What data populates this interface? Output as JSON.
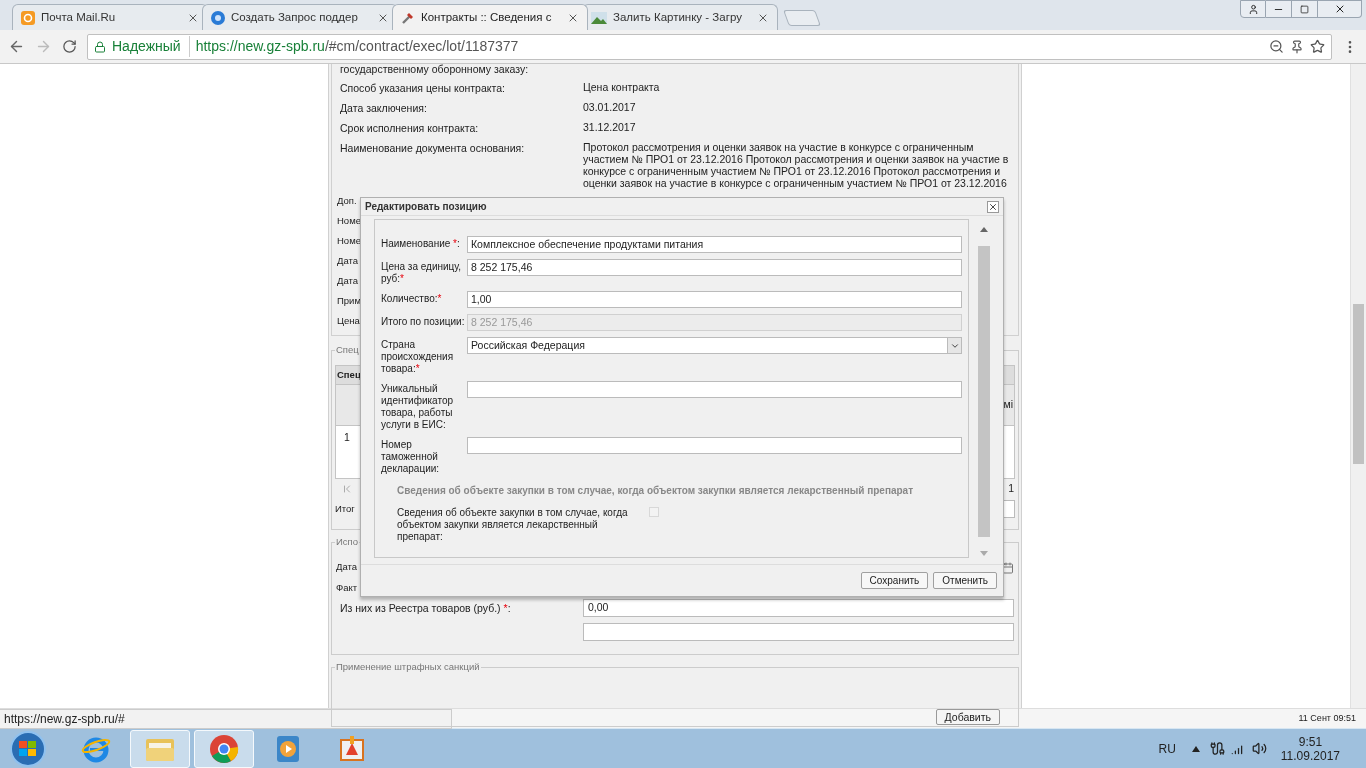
{
  "browser": {
    "tabs": [
      {
        "title": "Почта Mail.Ru",
        "kind": "mail",
        "selected": false
      },
      {
        "title": "Создать Запрос поддер",
        "kind": "help",
        "selected": false
      },
      {
        "title": "Контракты :: Сведения с",
        "kind": "tools",
        "selected": true
      },
      {
        "title": "Залить Картинку - Загру",
        "kind": "image",
        "selected": false
      }
    ],
    "security_label": "Надежный",
    "url_host": "https://new.gz-spb.ru",
    "url_path": "/#cm/contract/exec/lot/1187377"
  },
  "page": {
    "top_fields": [
      {
        "label": "государственному оборонному заказу:"
      },
      {
        "label": "Способ указания цены контракта:",
        "value": "Цена контракта"
      },
      {
        "label": "Дата заключения:",
        "value": "03.01.2017"
      },
      {
        "label": "Срок исполнения контракта:",
        "value": "31.12.2017"
      },
      {
        "label": "Наименование документа основания:",
        "value": "Протокол рассмотрения и оценки заявок на участие в конкурсе с ограниченным участием № ПРО1 от 23.12.2016 Протокол рассмотрения и оценки заявок на участие в конкурсе с ограниченным участием № ПРО1 от 23.12.2016 Протокол рассмотрения и оценки заявок на участие в конкурсе с ограниченным участием № ПРО1 от 23.12.2016"
      }
    ],
    "covered_labels": [
      "Доп.",
      "Номе",
      "Номе",
      "Дата",
      "Дата",
      "Прим",
      "Цена"
    ],
    "spec": {
      "legend": "Спец",
      "header": "Спец",
      "row_number": "1",
      "column_fragment": "мі",
      "page_fragment": "1",
      "total_label": "Итог"
    },
    "execution": {
      "legend": "Испо",
      "labels": [
        "Дата",
        "Факт"
      ],
      "registry": {
        "label": "Из них из Реестра товаров (руб.) ",
        "star": "*",
        "after": ":",
        "value": "0,00"
      }
    },
    "penalties": {
      "legend": "Применение штрафных санкций",
      "button": "Добавить"
    }
  },
  "dialog": {
    "title": "Редактировать позицию",
    "fields": [
      {
        "kind": "text",
        "label": "Наименование ",
        "star": "*",
        "after": ":",
        "value": "Комплексное обеспечение продуктами питания",
        "disabled": false
      },
      {
        "kind": "text",
        "label": "Цена за единицу, руб:",
        "star": "*",
        "value": "8 252 175,46",
        "disabled": false
      },
      {
        "kind": "text",
        "label": "Количество:",
        "star": "*",
        "value": "1,00",
        "disabled": false
      },
      {
        "kind": "text",
        "label": "Итого по позиции:",
        "value": "8 252 175,46",
        "disabled": true
      },
      {
        "kind": "select",
        "label": "Страна происхождения товара:",
        "star": "*",
        "value": "Российская Федерация",
        "disabled": false
      },
      {
        "kind": "text",
        "label": "Уникальный идентификатор товара, работы услуги в ЕИС:",
        "disabled": false
      },
      {
        "kind": "text",
        "label": "Номер таможенной декларации:",
        "disabled": false
      }
    ],
    "section_title": "Сведения об объекте закупки в том случае, когда объектом закупки является лекарственный препарат",
    "checkbox": {
      "label": "Сведения об объекте закупки в том случае, когда объектом закупки является лекарственный препарат:",
      "checked": false,
      "disabled": true
    },
    "buttons": [
      "Сохранить",
      "Отменить"
    ]
  },
  "status_url": "https://new.gz-spb.ru/#",
  "status_time": "11 Сент 09:51",
  "taskbar": {
    "apps": [
      {
        "kind": "ie",
        "active": false
      },
      {
        "kind": "explorer",
        "active": true
      },
      {
        "kind": "chrome",
        "active": true
      },
      {
        "kind": "media",
        "active": false
      },
      {
        "kind": "paint",
        "active": false
      }
    ],
    "language": "RU",
    "time": "9:51",
    "date": "11.09.2017"
  }
}
